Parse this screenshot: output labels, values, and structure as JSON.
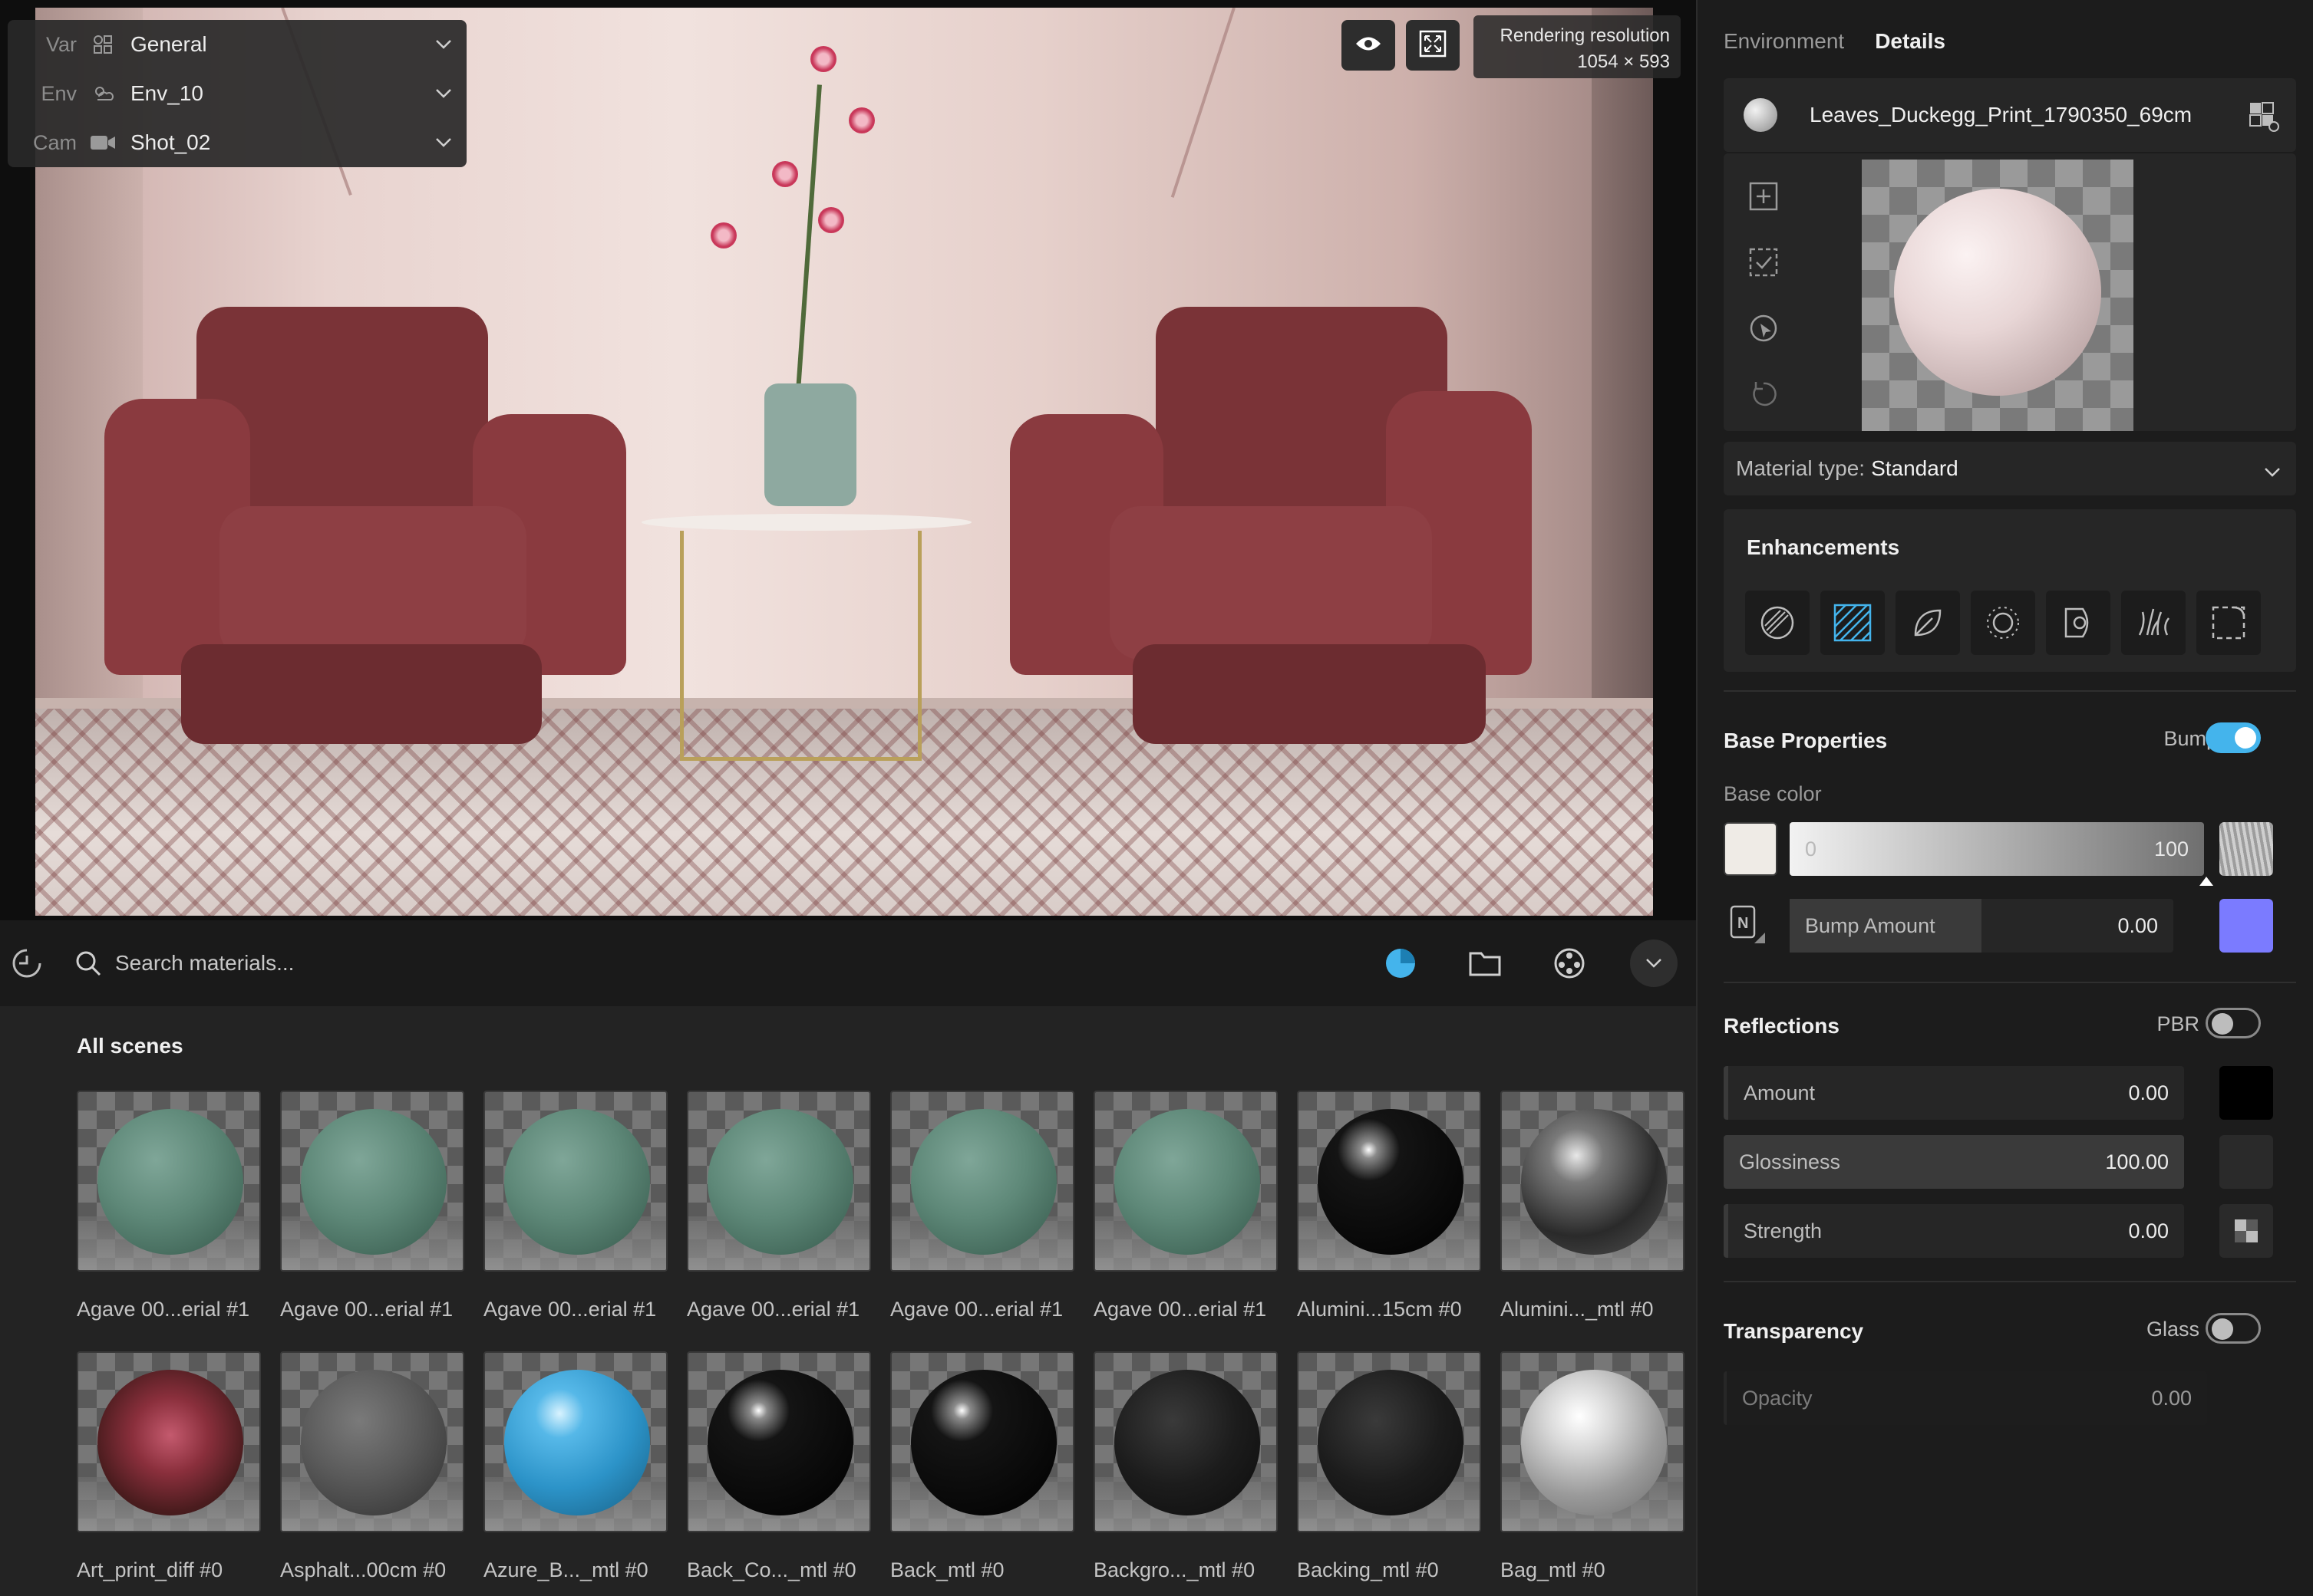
{
  "viewport": {
    "selectors": [
      {
        "key": "Var",
        "value": "General",
        "icon": "variant-icon"
      },
      {
        "key": "Env",
        "value": "Env_10",
        "icon": "environment-icon"
      },
      {
        "key": "Cam",
        "value": "Shot_02",
        "icon": "camera-icon"
      }
    ],
    "rendering_resolution_label": "Rendering resolution",
    "rendering_resolution_value": "1054 × 593"
  },
  "browser": {
    "search_placeholder": "Search materials...",
    "section_title": "All scenes",
    "row1": [
      {
        "label": "Agave 00...erial #1",
        "ball": "green"
      },
      {
        "label": "Agave 00...erial #1",
        "ball": "green"
      },
      {
        "label": "Agave 00...erial #1",
        "ball": "green"
      },
      {
        "label": "Agave 00...erial #1",
        "ball": "green"
      },
      {
        "label": "Agave 00...erial #1",
        "ball": "green"
      },
      {
        "label": "Agave 00...erial #1",
        "ball": "green"
      },
      {
        "label": "Alumini...15cm #0",
        "ball": "black-gloss"
      },
      {
        "label": "Alumini..._mtl #0",
        "ball": "chrome-dark"
      }
    ],
    "row2": [
      {
        "label": "Art_print_diff #0",
        "ball": "floral"
      },
      {
        "label": "Asphalt...00cm #0",
        "ball": "asphalt"
      },
      {
        "label": "Azure_B..._mtl #0",
        "ball": "azure"
      },
      {
        "label": "Back_Co..._mtl #0",
        "ball": "black-gloss"
      },
      {
        "label": "Back_mtl #0",
        "ball": "black-gloss"
      },
      {
        "label": "Backgro..._mtl #0",
        "ball": "black-matte"
      },
      {
        "label": "Backing_mtl #0",
        "ball": "black-matte"
      },
      {
        "label": "Bag_mtl #0",
        "ball": "silver"
      }
    ]
  },
  "panel": {
    "tabs": [
      "Environment",
      "Details"
    ],
    "active_tab": "Details",
    "material_name": "Leaves_Duckegg_Print_1790350_69cm",
    "material_type_key": "Material type:",
    "material_type_value": "Standard",
    "enhancements_title": "Enhancements",
    "base": {
      "title": "Base Properties",
      "bump_label": "Bump",
      "bump_on": true,
      "base_color_label": "Base color",
      "base_color_min": "0",
      "base_color_max": "100",
      "bump_amount_label": "Bump Amount",
      "bump_amount_value": "0.00",
      "swatch_color": "#efebe6",
      "bump_color": "#7b7bff"
    },
    "reflections": {
      "title": "Reflections",
      "pbr_label": "PBR",
      "pbr_on": false,
      "amount_label": "Amount",
      "amount_value": "0.00",
      "glossiness_label": "Glossiness",
      "glossiness_value": "100.00",
      "strength_label": "Strength",
      "strength_value": "0.00"
    },
    "transparency": {
      "title": "Transparency",
      "glass_label": "Glass",
      "glass_on": false,
      "opacity_label": "Opacity",
      "opacity_value": "0.00"
    }
  },
  "colors": {
    "accent": "#44b4ec",
    "panel_bg": "#1c1c1c",
    "browser_bg": "#232323"
  }
}
